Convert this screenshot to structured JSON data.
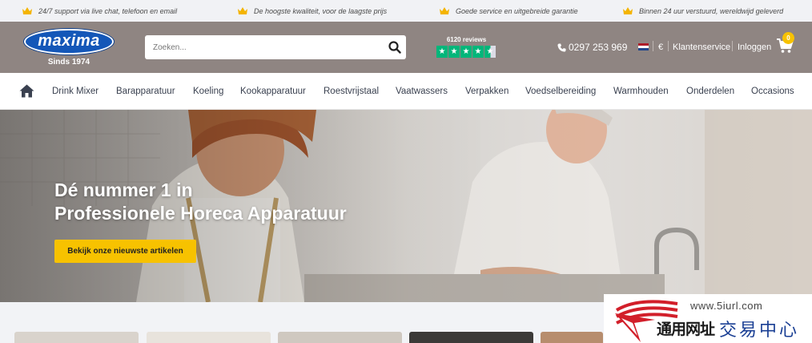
{
  "usp_bar": {
    "items": [
      {
        "text": "24/7 support via live chat, telefoon en email",
        "icon": "crown-icon"
      },
      {
        "text": "De hoogste kwaliteit, voor de laagste prijs",
        "icon": "crown-icon"
      },
      {
        "text": "Goede service en uitgebreide garantie",
        "icon": "crown-icon"
      },
      {
        "text": "Binnen 24 uur verstuurd, wereldwijd geleverd",
        "icon": "crown-icon"
      }
    ],
    "crown_color": "#f4b400"
  },
  "header": {
    "logo_text": "maxima",
    "logo_since": "Sinds 1974",
    "search_placeholder": "Zoeken...",
    "search_value": "",
    "reviews_count": "6120 reviews",
    "rating_stars": 4.5,
    "phone": "0297 253 969",
    "currency": "€",
    "customer_service": "Klantenservice",
    "login": "Inloggen",
    "cart_count": "0",
    "brand_color": "#8f8582",
    "accent_color": "#f7c200",
    "trustpilot_color": "#00b67a"
  },
  "nav": {
    "items": [
      "Drink Mixer",
      "Barapparatuur",
      "Koeling",
      "Kookapparatuur",
      "Roestvrijstaal",
      "Vaatwassers",
      "Verpakken",
      "Voedselbereiding",
      "Warmhouden",
      "Onderdelen",
      "Occasions"
    ]
  },
  "hero": {
    "title_line1": "Dé nummer 1 in",
    "title_line2": "Professionele Horeca Apparatuur",
    "cta_label": "Bekijk onze nieuwste artikelen"
  },
  "watermark": {
    "url": "www.5iurl.com",
    "cn_left": "通用网址",
    "cn_right": "交易中心"
  }
}
